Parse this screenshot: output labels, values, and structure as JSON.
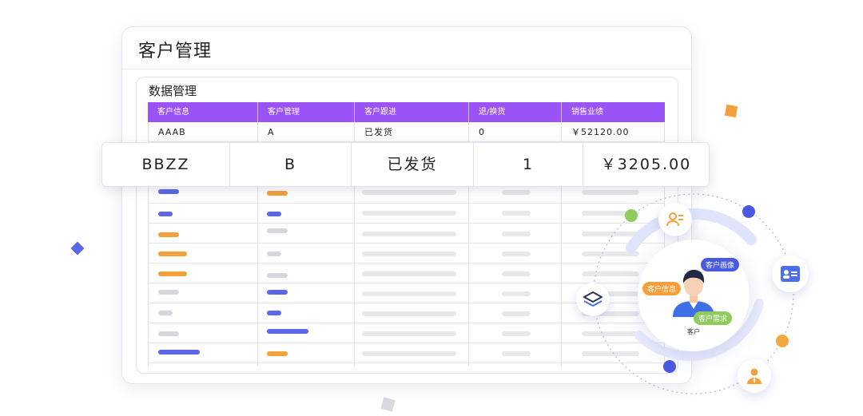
{
  "panel": {
    "title": "客户管理"
  },
  "data_panel": {
    "title": "数据管理",
    "columns": [
      "客户信息",
      "客户管理",
      "客户跟进",
      "退/换货",
      "销售业绩"
    ],
    "rows": [
      [
        "AAAB",
        "A",
        "已发货",
        "0",
        "￥52120.00"
      ]
    ]
  },
  "highlight_row": [
    "BBZZ",
    "B",
    "已发货",
    "1",
    "￥3205.00"
  ],
  "orbit": {
    "tags": [
      "客户画像",
      "客户信息",
      "客户需求"
    ],
    "center_label": "客户"
  },
  "colors": {
    "header": "#9b52f7",
    "blue": "#5b66e8",
    "orange": "#f5a03a",
    "green": "#8fcb5f"
  }
}
